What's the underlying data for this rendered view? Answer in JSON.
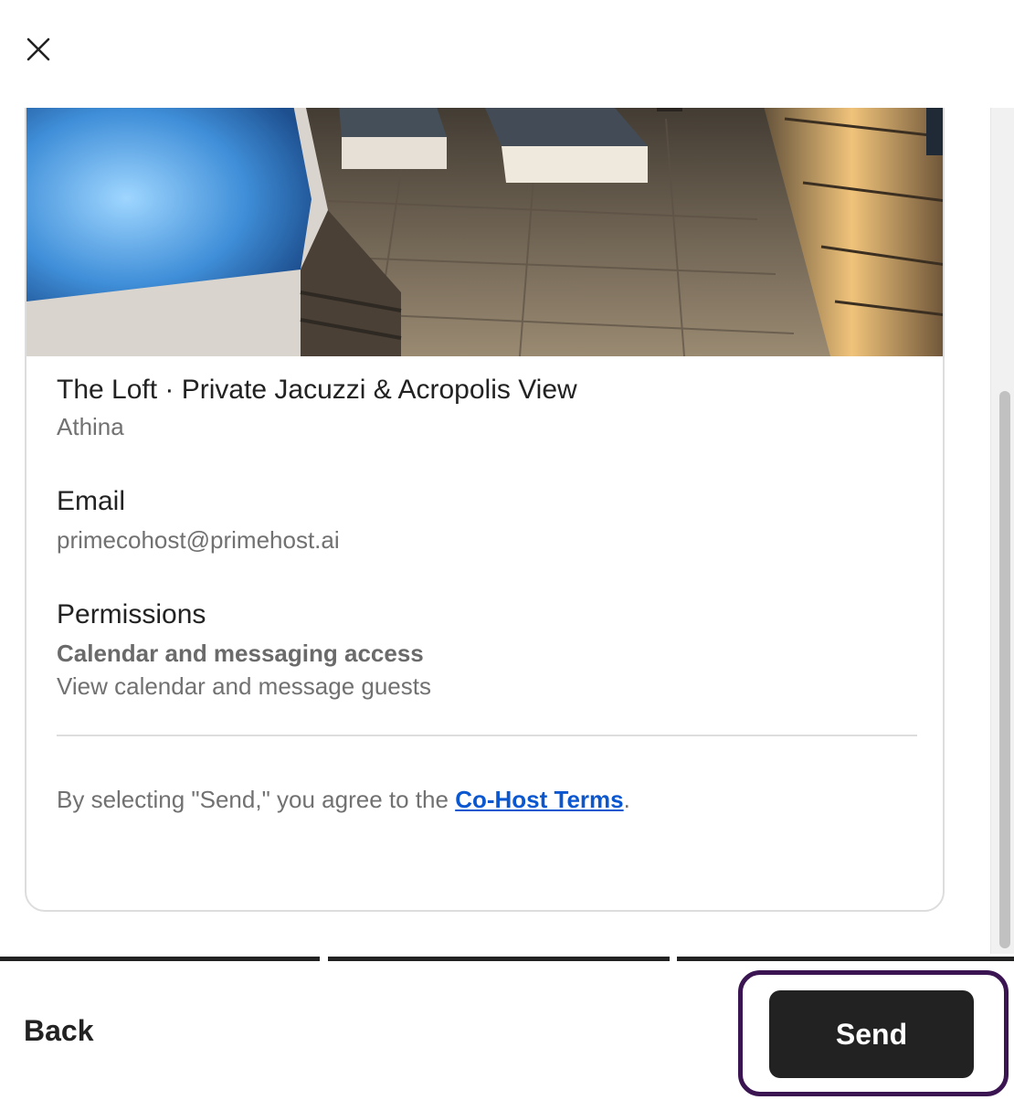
{
  "listing": {
    "title": "The Loft · Private Jacuzzi & Acropolis View",
    "location": "Athina"
  },
  "email": {
    "heading": "Email",
    "value": "primecohost@primehost.ai"
  },
  "permissions": {
    "heading": "Permissions",
    "title": "Calendar and messaging access",
    "description": "View calendar and message guests"
  },
  "terms": {
    "prefix": "By selecting \"Send,\" you agree to the ",
    "link": "Co-Host Terms",
    "suffix": "."
  },
  "footer": {
    "back_label": "Back",
    "send_label": "Send"
  },
  "progress_steps_completed": 3,
  "colors": {
    "primary_text": "#222222",
    "secondary_text": "#717171",
    "link": "#0b57d0",
    "button_bg": "#222222",
    "focus_ring": "#3b1452"
  }
}
